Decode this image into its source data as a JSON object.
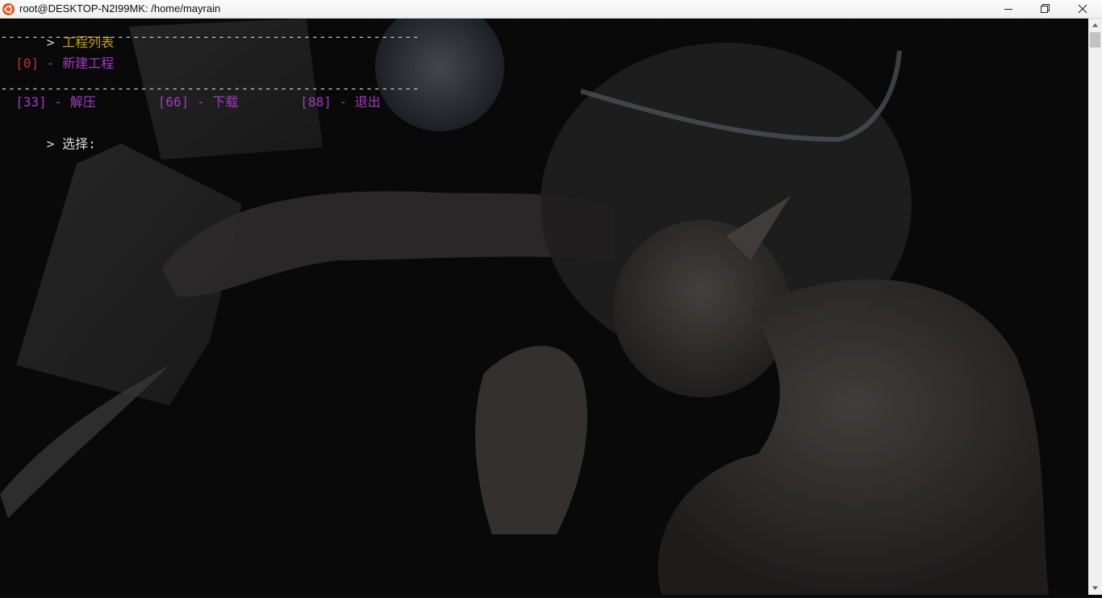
{
  "window": {
    "title": "root@DESKTOP-N2I99MK: /home/mayrain",
    "icon": "ubuntu-icon"
  },
  "terminal": {
    "prompt_symbol": ">",
    "header": "工程列表",
    "separator": "------------------------------------------------------",
    "projects": [
      {
        "key": "[0]",
        "dash": " - ",
        "label": "新建工程"
      }
    ],
    "actions": [
      {
        "key": "[33]",
        "dash": " - ",
        "label": "解压"
      },
      {
        "key": "[66]",
        "dash": " - ",
        "label": "下载"
      },
      {
        "key": "[88]",
        "dash": " - ",
        "label": "退出"
      }
    ],
    "input_prompt": "选择:"
  },
  "colors": {
    "header": "#c4a000",
    "project_key": "#cc2b2b",
    "action": "#a43ac4",
    "titlebar_bg": "#f5f5f5"
  }
}
